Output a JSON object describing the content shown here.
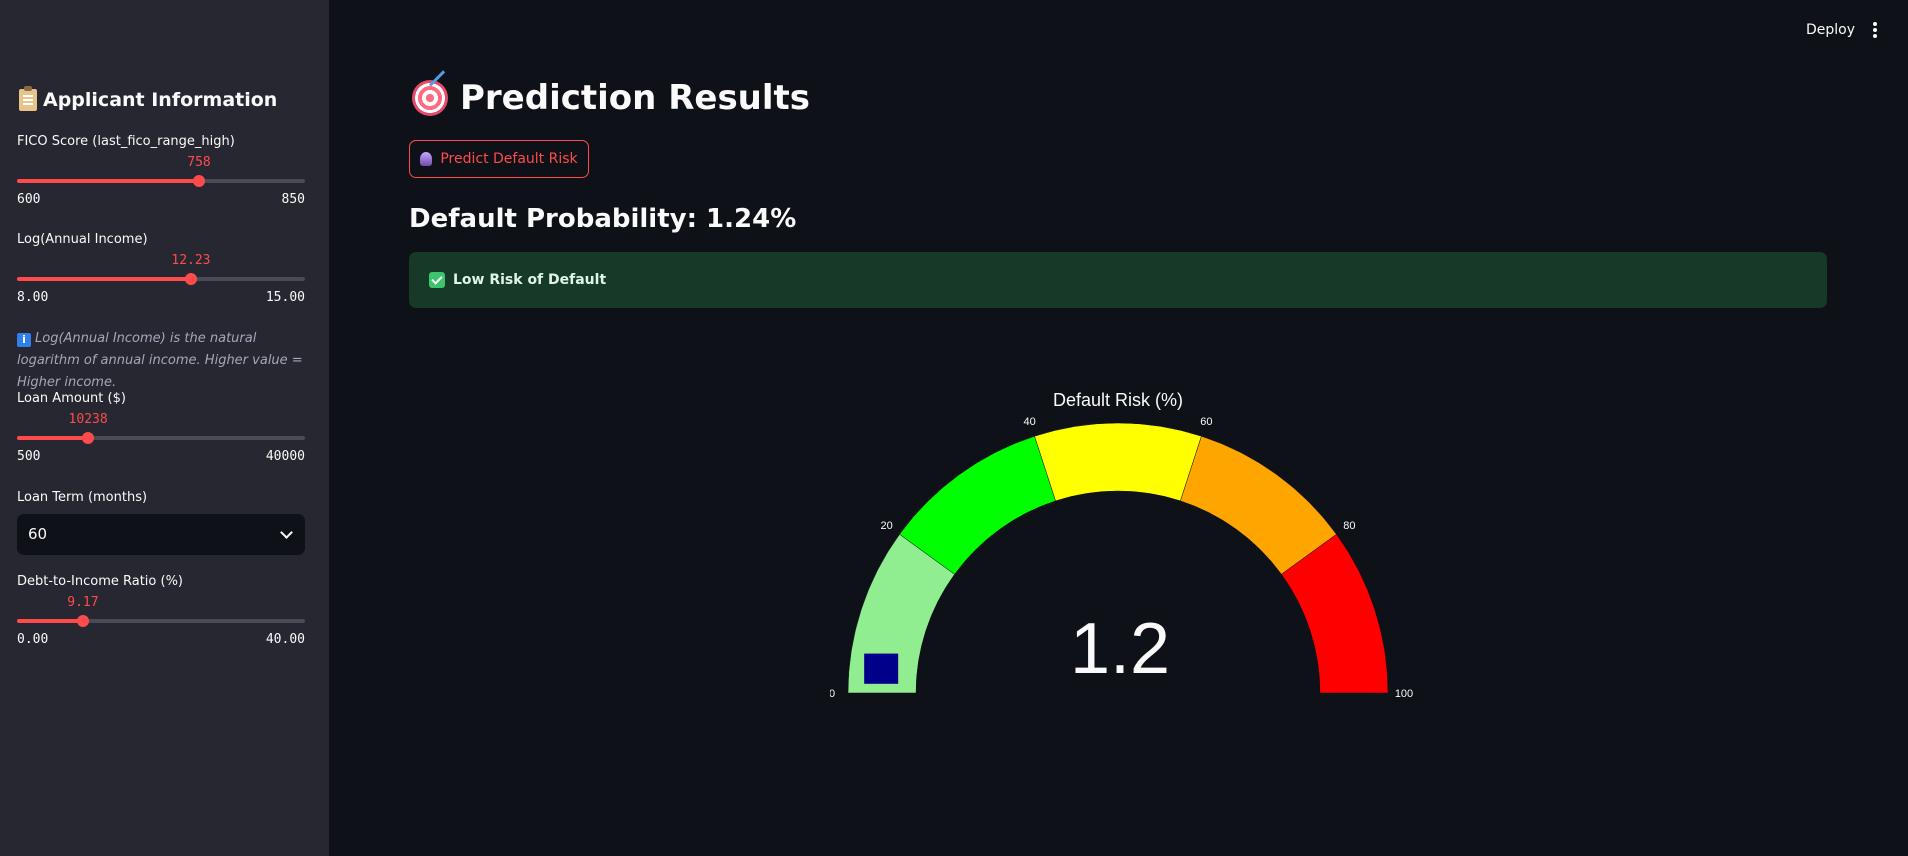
{
  "header": {
    "deploy_label": "Deploy"
  },
  "sidebar": {
    "title": "Applicant Information",
    "fico": {
      "label": "FICO Score (last_fico_range_high)",
      "value": "758",
      "min": "600",
      "max": "850",
      "fraction": 0.632
    },
    "income": {
      "label": "Log(Annual Income)",
      "value": "12.23",
      "min": "8.00",
      "max": "15.00",
      "fraction": 0.604
    },
    "info_text": "Log(Annual Income) is the natural logarithm of annual income. Higher value = Higher income.",
    "loan": {
      "label": "Loan Amount ($)",
      "value": "10238",
      "min": "500",
      "max": "40000",
      "fraction": 0.247
    },
    "term": {
      "label": "Loan Term (months)",
      "value": "60"
    },
    "dti": {
      "label": "Debt-to-Income Ratio (%)",
      "value": "9.17",
      "min": "0.00",
      "max": "40.00",
      "fraction": 0.229
    }
  },
  "main": {
    "title": "Prediction Results",
    "predict_button": "Predict Default Risk",
    "probability_text": "Default Probability: 1.24%",
    "risk_alert": "Low Risk of Default"
  },
  "chart_data": {
    "type": "gauge",
    "title": "Default Risk (%)",
    "value": 1.24,
    "value_display": "1.2",
    "range": [
      0,
      100
    ],
    "ticks": [
      "0",
      "20",
      "40",
      "60",
      "80",
      "100"
    ],
    "steps": [
      {
        "range": [
          0,
          20
        ],
        "color": "#90ee90"
      },
      {
        "range": [
          20,
          40
        ],
        "color": "#00ff00"
      },
      {
        "range": [
          40,
          60
        ],
        "color": "#ffff00"
      },
      {
        "range": [
          60,
          80
        ],
        "color": "#ffa500"
      },
      {
        "range": [
          80,
          100
        ],
        "color": "#ff0000"
      }
    ],
    "bar_color": "#00008b"
  }
}
